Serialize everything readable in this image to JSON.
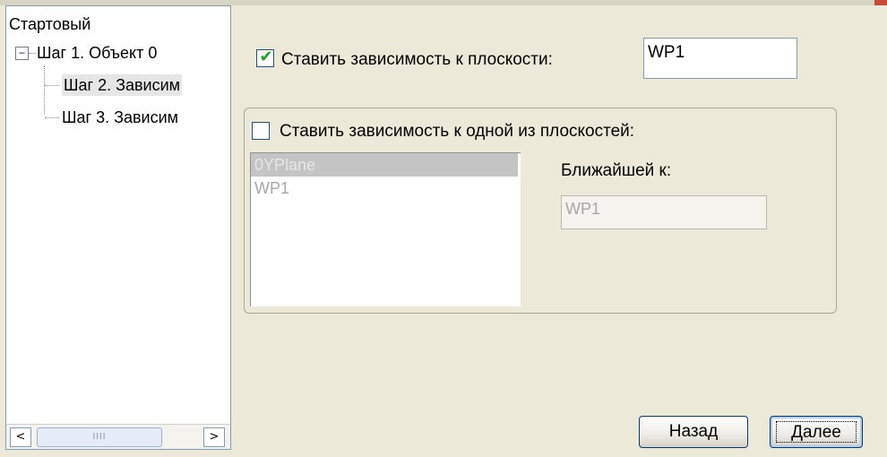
{
  "tree": {
    "root": "Стартовый",
    "expander_symbol": "−",
    "items": [
      {
        "label": "Шаг 1. Объект 0"
      },
      {
        "label": "Шаг 2. Зависим"
      },
      {
        "label": "Шаг 3. Зависим"
      }
    ],
    "scroll": {
      "left_arrow": "<",
      "right_arrow": ">",
      "thumb_grip": "IIII"
    }
  },
  "plane_dependency": {
    "checked": true,
    "check_mark": "✔",
    "label": "Ставить зависимость к плоскости:",
    "value": "WP1"
  },
  "group": {
    "checked": false,
    "label": "Ставить зависимость к одной из плоскостей:",
    "planes": [
      "0YPlane",
      "WP1"
    ],
    "selected_index": 0,
    "nearest_label": "Ближайшей к:",
    "nearest_value": "WP1"
  },
  "buttons": {
    "back": "Назад",
    "next": "Далее"
  },
  "colors": {
    "window_bg": "#ece9d8",
    "check_mark": "#21a121",
    "disabled_text": "#a7a7a7",
    "selection_bg": "#c4c4c4"
  }
}
